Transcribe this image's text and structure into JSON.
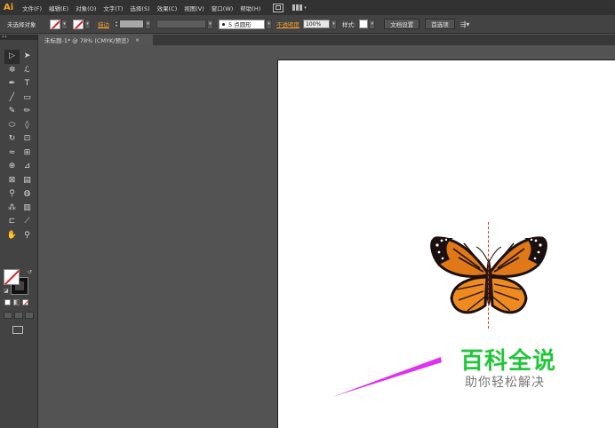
{
  "app": {
    "logo": "Ai"
  },
  "menu": [
    "文件(F)",
    "编辑(E)",
    "对象(O)",
    "文字(T)",
    "选择(S)",
    "效果(C)",
    "视图(V)",
    "窗口(W)",
    "帮助(H)"
  ],
  "control_bar": {
    "selection_label": "未选择对象",
    "stroke_label": "描边",
    "brush_size": "5 点圆形",
    "opacity_label": "不透明度",
    "opacity_value": "100%",
    "style_label": "样式:",
    "document_setup_button": "文档设置",
    "preferences_button": "首选项"
  },
  "document_tab": {
    "title": "未标题-1* @ 78% (CMYK/预览)",
    "close": "×"
  },
  "tools_panel": {
    "header": "••",
    "tools": [
      {
        "icon": "selection-icon",
        "glyph": "▷"
      },
      {
        "icon": "direct-selection-icon",
        "glyph": "➤"
      },
      {
        "icon": "magic-wand-icon",
        "glyph": "✲"
      },
      {
        "icon": "lasso-icon",
        "glyph": "ℒ"
      },
      {
        "icon": "pen-icon",
        "glyph": "✒"
      },
      {
        "icon": "type-icon",
        "glyph": "T"
      },
      {
        "icon": "line-segment-icon",
        "glyph": "╱"
      },
      {
        "icon": "rectangle-icon",
        "glyph": "▭"
      },
      {
        "icon": "paintbrush-icon",
        "glyph": "✎"
      },
      {
        "icon": "pencil-icon",
        "glyph": "✏"
      },
      {
        "icon": "blob-brush-icon",
        "glyph": "⬭"
      },
      {
        "icon": "eraser-icon",
        "glyph": "◊"
      },
      {
        "icon": "rotate-icon",
        "glyph": "↻"
      },
      {
        "icon": "scale-icon",
        "glyph": "⊡"
      },
      {
        "icon": "width-icon",
        "glyph": "≈"
      },
      {
        "icon": "free-transform-icon",
        "glyph": "⊞"
      },
      {
        "icon": "shape-builder-icon",
        "glyph": "⊕"
      },
      {
        "icon": "perspective-grid-icon",
        "glyph": "⊿"
      },
      {
        "icon": "mesh-icon",
        "glyph": "⊠"
      },
      {
        "icon": "gradient-icon",
        "glyph": "▤"
      },
      {
        "icon": "eyedropper-icon",
        "glyph": "⚲"
      },
      {
        "icon": "blend-icon",
        "glyph": "◍"
      },
      {
        "icon": "symbol-sprayer-icon",
        "glyph": "⁂"
      },
      {
        "icon": "column-graph-icon",
        "glyph": "▥"
      },
      {
        "icon": "artboard-icon",
        "glyph": "⊏"
      },
      {
        "icon": "slice-icon",
        "glyph": "⟋"
      },
      {
        "icon": "hand-icon",
        "glyph": "✋"
      },
      {
        "icon": "zoom-icon",
        "glyph": "⚲"
      }
    ]
  },
  "watermark": {
    "title": "百科全说",
    "subtitle": "助你轻松解决"
  },
  "colors": {
    "accent": "#f7a51c",
    "link": "#f0a030",
    "watermark": "#22c63a",
    "pointer": "#e030f0",
    "guide": "#e0301e"
  }
}
